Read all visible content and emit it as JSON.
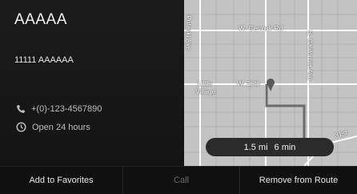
{
  "place": {
    "name": "AAAAA",
    "address": "11111 AAAAAA",
    "phone": "+(0)-123-4567890",
    "hours": "Open 24 hours"
  },
  "map": {
    "labels": {
      "cermak": "W. Cermak Rd",
      "california": "S. California Ave",
      "little_village_1": "Little",
      "little_village_2": "Village",
      "w26th": "W. 26th",
      "pulaski": "Pulaski Ave",
      "st31": "31st"
    }
  },
  "route": {
    "distance": "1.5 mi",
    "duration": "6 min"
  },
  "actions": {
    "favorites": "Add to Favorites",
    "call": "Call",
    "remove": "Remove from Route"
  },
  "colors": {
    "background": "#141414",
    "map": "#bdbdbd",
    "disabled_text": "#6a6a6a"
  }
}
